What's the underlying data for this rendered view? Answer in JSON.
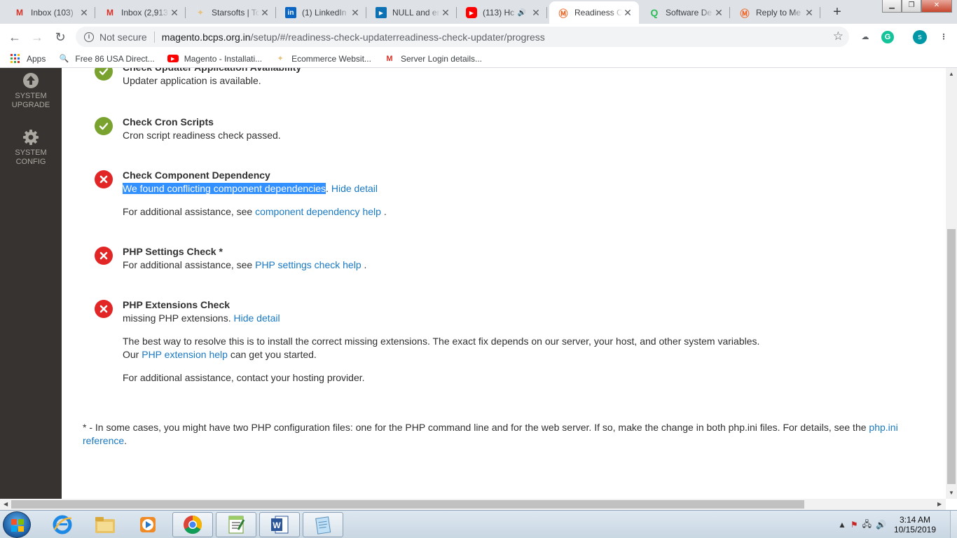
{
  "tabs": [
    {
      "title": "Inbox (103)",
      "favicon": "gmail-icon",
      "color": "#d93025"
    },
    {
      "title": "Inbox (2,913",
      "favicon": "gmail-icon",
      "color": "#d93025"
    },
    {
      "title": "Starsofts | Tc",
      "favicon": "starsofts-icon",
      "color": "#e6c27a"
    },
    {
      "title": "(1) LinkedIn",
      "favicon": "linkedin-icon",
      "color": "#0a66c2"
    },
    {
      "title": "NULL and er",
      "favicon": "site-icon",
      "color": "#0e71b3"
    },
    {
      "title": "(113) Hc",
      "favicon": "youtube-icon",
      "color": "#ff0000",
      "audio": true
    },
    {
      "title": "Readiness C",
      "favicon": "magento-icon",
      "color": "#f26322",
      "active": true
    },
    {
      "title": "Software De",
      "favicon": "quora-icon",
      "color": "#2ebd59"
    },
    {
      "title": "Reply to Me",
      "favicon": "magento-icon",
      "color": "#f26322"
    }
  ],
  "omnibox": {
    "security": "Not secure",
    "host": "magento.bcps.org.in",
    "path": "/setup/#/readiness-check-updaterreadiness-check-updater/progress"
  },
  "profile_initial": "s",
  "bookmarks": [
    {
      "label": "Apps",
      "icon": "apps-icon"
    },
    {
      "label": "Free 86 USA Direct...",
      "icon": "search-icon"
    },
    {
      "label": "Magento - Installati...",
      "icon": "youtube-icon"
    },
    {
      "label": "Ecommerce Websit...",
      "icon": "star-icon"
    },
    {
      "label": "Server Login details...",
      "icon": "gmail-icon"
    }
  ],
  "sidebar": {
    "upgrade": {
      "line1": "SYSTEM",
      "line2": "UPGRADE"
    },
    "config": {
      "line1": "SYSTEM",
      "line2": "CONFIG"
    }
  },
  "checks": {
    "updater": {
      "title": "Check Updater Application Availability",
      "status": "passed",
      "message": "Updater application is available."
    },
    "cron": {
      "title": "Check Cron Scripts",
      "status": "passed",
      "message": "Cron script readiness check passed."
    },
    "dependency": {
      "title": "Check Component Dependency",
      "status": "failed",
      "message_selected": "We found conflicting component dependencies",
      "message_after": ".",
      "hide_detail": "Hide detail",
      "assist_pre": "For additional assistance, see",
      "assist_link": "component dependency help",
      "assist_post": "."
    },
    "php_settings": {
      "title": "PHP Settings Check *",
      "status": "failed",
      "assist_pre": "For additional assistance, see",
      "assist_link": "PHP settings check help",
      "assist_post": "."
    },
    "php_extensions": {
      "title": "PHP Extensions Check",
      "status": "failed",
      "message": "missing PHP extensions.",
      "hide_detail": "Hide detail",
      "detail1": "The best way to resolve this is to install the correct missing extensions. The exact fix depends on our server, your host, and other system variables.",
      "detail2_pre": "Our",
      "detail2_link": "PHP extension help",
      "detail2_post": "can get you started.",
      "detail3": "For additional assistance, contact your hosting provider."
    }
  },
  "footnote": {
    "text": "* - In some cases, you might have two PHP configuration files: one for the PHP command line and for the web server. If so, make the change in both php.ini files. For details, see the",
    "link": "php.ini reference",
    "post": "."
  },
  "taskbar": {
    "time": "3:14 AM",
    "date": "10/15/2019",
    "apps": [
      "internet-explorer-icon",
      "file-explorer-icon",
      "media-player-icon",
      "chrome-icon",
      "notepad-plus-icon",
      "word-icon",
      "notepad-icon"
    ]
  },
  "colors": {
    "sidebar_bg": "#373330",
    "link": "#1979c3",
    "success": "#79a22e",
    "error": "#e22626",
    "selection": "#3390ff"
  }
}
